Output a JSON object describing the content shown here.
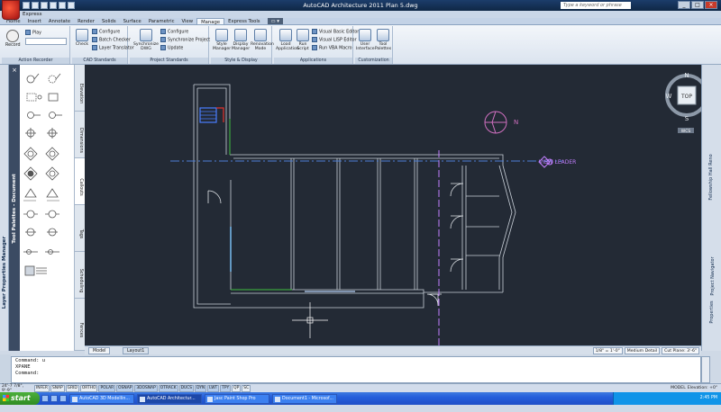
{
  "window": {
    "title": "AutoCAD Architecture 2011    Plan 5.dwg",
    "search_placeholder": "Type a keyword or phrase",
    "workspace": "Express"
  },
  "ribbon": {
    "tabs": [
      "Home",
      "Insert",
      "Annotate",
      "Render",
      "Solids",
      "Surface",
      "Parametric",
      "View",
      "Manage",
      "Express Tools"
    ],
    "active_tab": "Manage",
    "panels": {
      "action_recorder": {
        "title": "Action Recorder",
        "record": "Record",
        "play": "Play"
      },
      "cad_standards": {
        "title": "CAD Standards",
        "check": "Check",
        "configure": "Configure",
        "batch_checker": "Batch Checker",
        "layer_translator": "Layer Translator"
      },
      "project_standards": {
        "title": "Project Standards",
        "synchronize_dwg": "Synchronize DWG",
        "configure": "Configure",
        "synchronize_project": "Synchronize Project",
        "update": "Update"
      },
      "style_display": {
        "title": "Style & Display",
        "style_manager": "Style Manager",
        "display_manager": "Display Manager",
        "renovation_mode": "Renovation Mode"
      },
      "applications": {
        "title": "Applications",
        "load_application": "Load Application",
        "run_script": "Run Script",
        "vb_editor": "Visual Basic Editor",
        "lisp_editor": "Visual LISP Editor",
        "run_vba": "Run VBA Macro"
      },
      "customization": {
        "title": "Customization",
        "user_interface": "User Interface",
        "tool_palettes": "Tool Palettes"
      }
    }
  },
  "left_palette": {
    "label": "Layer Properties Manager"
  },
  "tool_palettes": {
    "label": "Tool Palettes - Document",
    "tabs": [
      "Elevation",
      "Dimensions",
      "Callouts",
      "Tags",
      "Scheduling",
      "Fences"
    ],
    "active_tab": "Callouts"
  },
  "drawing": {
    "north_arrow_label": "N",
    "label_near_arrow": "VIEW LEADER",
    "viewcube": {
      "face": "TOP",
      "n": "N",
      "s": "S",
      "e": "E",
      "w": "W",
      "wcs": "WCS"
    }
  },
  "right_palettes": {
    "items": [
      "Fellowship Hall Reno",
      "Project Navigator",
      "Properties"
    ]
  },
  "layout_tabs": {
    "model": "Model",
    "layout": "Layout1",
    "scale": "1/8\" = 1'-0\"",
    "detail": "Medium Detail",
    "cut_plane": "Cut Plane: 3'-6\""
  },
  "command_line": {
    "lines": [
      "Command: u",
      "XPANE",
      "Command:"
    ]
  },
  "status_bar": {
    "coords": "24'-7 7/8\", 9'-9\"",
    "toggles": [
      "INFER",
      "SNAP",
      "GRID",
      "ORTHO",
      "POLAR",
      "OSNAP",
      "3DOSNAP",
      "OTRACK",
      "DUCS",
      "DYN",
      "LWT",
      "TPY",
      "QP",
      "SC"
    ],
    "active_toggles": [
      "POLAR",
      "OSNAP",
      "3DOSNAP",
      "OTRACK",
      "DUCS",
      "DYN",
      "LWT",
      "TPY"
    ],
    "model": "MODEL",
    "elevation": "Elevation: +0\""
  },
  "taskbar": {
    "start": "start",
    "apps": [
      "AutoCAD 3D Modellin...",
      "AutoCAD Architectur...",
      "Jasc Paint Shop Pro",
      "Document1 - Microsof..."
    ],
    "active_app": 1,
    "clock": "2:45 PM"
  }
}
